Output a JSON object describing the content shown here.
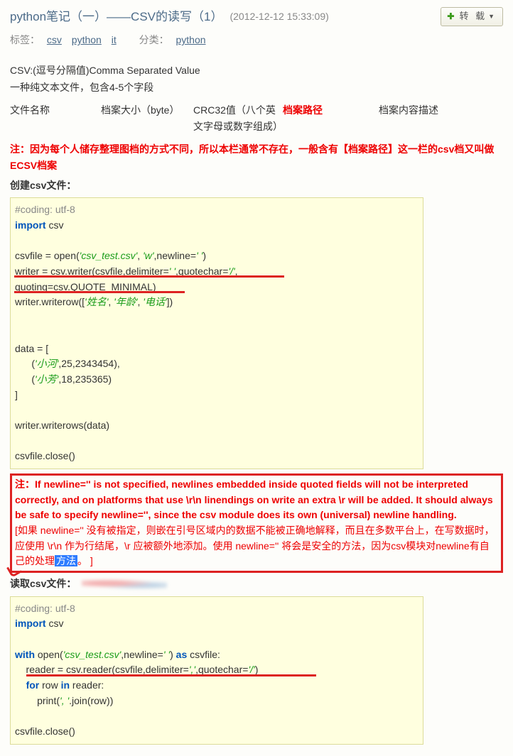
{
  "header": {
    "title": "python笔记（一）——CSV的读写（1）",
    "date": "(2012-12-12 15:33:09)",
    "repost": "转 载"
  },
  "meta": {
    "tags_label": "标签：",
    "tags": [
      "csv",
      "python",
      "it"
    ],
    "cat_label": "分类：",
    "cat": "python"
  },
  "intro": {
    "l1": "CSV:(逗号分隔值)Comma Separated Value",
    "l2": "一种纯文本文件，包含4-5个字段"
  },
  "cols": {
    "c1": "文件名称",
    "c2": "档案大小（byte）",
    "c3": "CRC32值（八个英文字母或数字组成）",
    "c4": "档案路径",
    "c5": "档案内容描述"
  },
  "warn": "注：因为每个人储存整理图档的方式不同，所以本栏通常不存在，一般含有【档案路径】这一栏的csv档又叫做ECSV档案",
  "sect1": "创建csv文件：",
  "code1": {
    "comment": "#coding: utf-8",
    "import_kw": "import",
    "import_mod": " csv",
    "open_pre": "csvfile = open(",
    "open_s1": "'csv_test.csv'",
    "open_mid1": ", ",
    "open_s2": "'w'",
    "open_mid2": ",newline=",
    "open_s3": "' '",
    "open_post": ")",
    "writer_line": "writer = csv.writer(csvfile,delimiter=",
    "writer_s1": "' '",
    "writer_mid": ",quotechar=",
    "writer_s2": "'/'",
    "writer_tail": ",",
    "quoting_line": "quoting=csv.QUOTE_MINIMAL)",
    "wr_pre": "writer.writerow([",
    "wr_s1": "'姓名'",
    "wr_c1": ", ",
    "wr_s2": "'年龄'",
    "wr_c2": ", ",
    "wr_s3": "'电话'",
    "wr_post": "])",
    "data_open": "data = [",
    "d1_pre": "      (",
    "d1_s": "'小河'",
    "d1_post": ",25,2343454),",
    "d2_pre": "      (",
    "d2_s": "'小芳'",
    "d2_post": ",18,235365)",
    "data_close": "]",
    "writerows": "writer.writerows(data)",
    "close": "csvfile.close()"
  },
  "bignote": {
    "en": "注：If newline='' is not specified, newlines embedded inside quoted fields will not be interpreted correctly, and on platforms that use \\r\\n linendings on write an extra \\r will be added. It should always be safe to specify newline='', since the csv module does its own (universal) newline handling.",
    "cn_pre": "[如果 newline='' 没有被指定，则嵌在引号区域内的数据不能被正确地解释，而且在多数平台上，在写数据时，应使用 \\r\\n 作为行结尾，\\r 应被额外地添加。使用 newline='' 将会是安全的方法，因为csv模块对newline有自己的处理",
    "cn_hl": "方法",
    "cn_post": "。 ]"
  },
  "sect2": "读取csv文件：",
  "code2": {
    "comment": "#coding: utf-8",
    "import_kw": "import",
    "import_mod": " csv",
    "with_kw": "with",
    "with_pre": " open(",
    "with_s1": "'csv_test.csv'",
    "with_mid": ",newline=",
    "with_s2": "' '",
    "with_post": ") ",
    "as_kw": "as",
    "as_post": " csvfile:",
    "reader_pre": "    reader = csv.reader(csvfile,delimiter=",
    "reader_s1": "','",
    "reader_mid": ",quotechar=",
    "reader_s2": "'/'",
    "reader_post": ")",
    "for_kw": "for",
    "for_mid": " row ",
    "in_kw": "in",
    "for_post": " reader:",
    "print_pre": "        print(",
    "print_s": "', '",
    "print_post": ".join(row))",
    "close": "csvfile.close()"
  }
}
